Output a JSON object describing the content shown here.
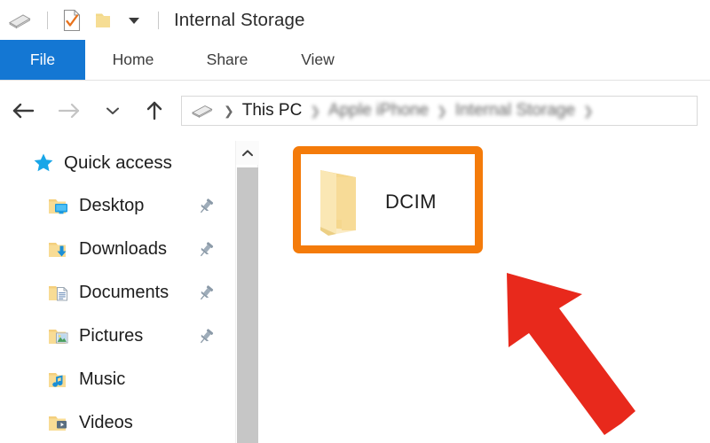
{
  "window": {
    "title": "Internal Storage"
  },
  "quick_access_toolbar": {
    "items": [
      {
        "name": "drive-icon",
        "label": "Device"
      },
      {
        "name": "properties-icon",
        "label": "Properties"
      },
      {
        "name": "new-folder-icon",
        "label": "New folder"
      },
      {
        "name": "chevron-down-icon",
        "label": "Customize Quick Access Toolbar"
      }
    ]
  },
  "ribbon": {
    "tabs": [
      {
        "label": "File",
        "active": true
      },
      {
        "label": "Home",
        "active": false
      },
      {
        "label": "Share",
        "active": false
      },
      {
        "label": "View",
        "active": false
      }
    ],
    "active_color": "#1477d3"
  },
  "navigation": {
    "back_label": "Back",
    "forward_label": "Forward",
    "recent_label": "Recent locations",
    "up_label": "Up",
    "breadcrumb": [
      {
        "label": "This PC",
        "blurred": false
      },
      {
        "label": "Apple iPhone",
        "blurred": true
      },
      {
        "label": "Internal Storage",
        "blurred": true
      }
    ],
    "trailing_separator": true
  },
  "sidebar": {
    "items": [
      {
        "label": "Quick access",
        "icon": "star-icon",
        "level": "root",
        "pinned": false
      },
      {
        "label": "Desktop",
        "icon": "desktop-folder-icon",
        "level": "child",
        "pinned": true
      },
      {
        "label": "Downloads",
        "icon": "downloads-folder-icon",
        "level": "child",
        "pinned": true
      },
      {
        "label": "Documents",
        "icon": "documents-folder-icon",
        "level": "child",
        "pinned": true
      },
      {
        "label": "Pictures",
        "icon": "pictures-folder-icon",
        "level": "child",
        "pinned": true
      },
      {
        "label": "Music",
        "icon": "music-folder-icon",
        "level": "child",
        "pinned": false
      },
      {
        "label": "Videos",
        "icon": "videos-folder-icon",
        "level": "child",
        "pinned": false
      }
    ]
  },
  "scrollbar": {
    "up_label": "Scroll up",
    "thumb_label": "Vertical scroll thumb"
  },
  "file_pane": {
    "items": [
      {
        "label": "DCIM",
        "icon": "open-folder-icon",
        "selected": false
      }
    ]
  },
  "annotations": {
    "highlight_box": {
      "target": "DCIM",
      "color": "#f47b0a"
    },
    "arrow": {
      "target": "DCIM",
      "color": "#e8291c",
      "direction": "up-left"
    }
  }
}
